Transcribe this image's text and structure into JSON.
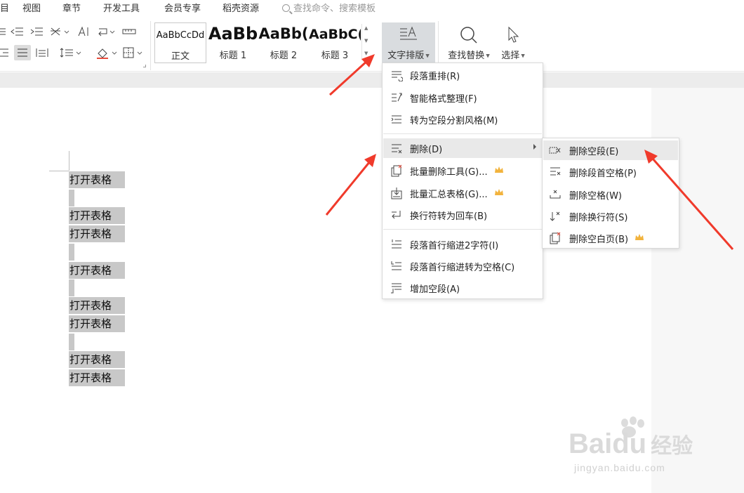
{
  "menubar": {
    "items": [
      "视图",
      "章节",
      "开发工具",
      "会员专享",
      "稻壳资源"
    ],
    "search_placeholder": "查找命令、搜索模板"
  },
  "ribbon": {
    "styles": [
      {
        "sample": "AaBbCcDd",
        "label": "正文"
      },
      {
        "sample": "AaBb",
        "label": "标题 1"
      },
      {
        "sample": "AaBb(",
        "label": "标题 2"
      },
      {
        "sample": "AaBbC(",
        "label": "标题 3"
      }
    ],
    "text_layout_label": "文字排版",
    "find_replace_label": "查找替换",
    "select_label": "选择"
  },
  "document": {
    "lines": [
      "打开表格",
      "打开表格",
      "打开表格",
      "打开表格",
      "打开表格",
      "打开表格",
      "打开表格",
      "打开表格"
    ]
  },
  "dropdown": {
    "items": [
      {
        "label": "段落重排(R)",
        "icon": "paragraph-rearrange-icon"
      },
      {
        "label": "智能格式整理(F)",
        "icon": "smart-format-icon"
      },
      {
        "label": "转为空段分割风格(M)",
        "icon": "empty-paragraph-style-icon"
      },
      {
        "label": "删除(D)",
        "icon": "delete-lines-icon",
        "submenu": true
      },
      {
        "label": "批量删除工具(G)...",
        "icon": "batch-delete-icon",
        "premium": true
      },
      {
        "label": "批量汇总表格(G)...",
        "icon": "batch-summary-icon",
        "premium": true
      },
      {
        "label": "换行符转为回车(B)",
        "icon": "line-break-icon"
      },
      {
        "label": "段落首行缩进2字符(I)",
        "icon": "indent-icon"
      },
      {
        "label": "段落首行缩进转为空格(C)",
        "icon": "indent-to-space-icon"
      },
      {
        "label": "增加空段(A)",
        "icon": "add-paragraph-icon"
      }
    ]
  },
  "submenu": {
    "items": [
      {
        "label": "删除空段(E)",
        "icon": "delete-empty-paragraph-icon"
      },
      {
        "label": "删除段首空格(P)",
        "icon": "delete-leading-space-icon"
      },
      {
        "label": "删除空格(W)",
        "icon": "delete-space-icon"
      },
      {
        "label": "删除换行符(S)",
        "icon": "delete-linebreak-icon"
      },
      {
        "label": "删除空白页(B)",
        "icon": "delete-blank-page-icon",
        "premium": true
      }
    ]
  },
  "watermark": {
    "brand": "Baidu",
    "cn": "经验",
    "url": "jingyan.baidu.com"
  },
  "colors": {
    "arrow": "#f03a2b",
    "crown": "#f2b33d",
    "menu_hover": "#e9e9e9",
    "selection": "#c8c8c8"
  }
}
